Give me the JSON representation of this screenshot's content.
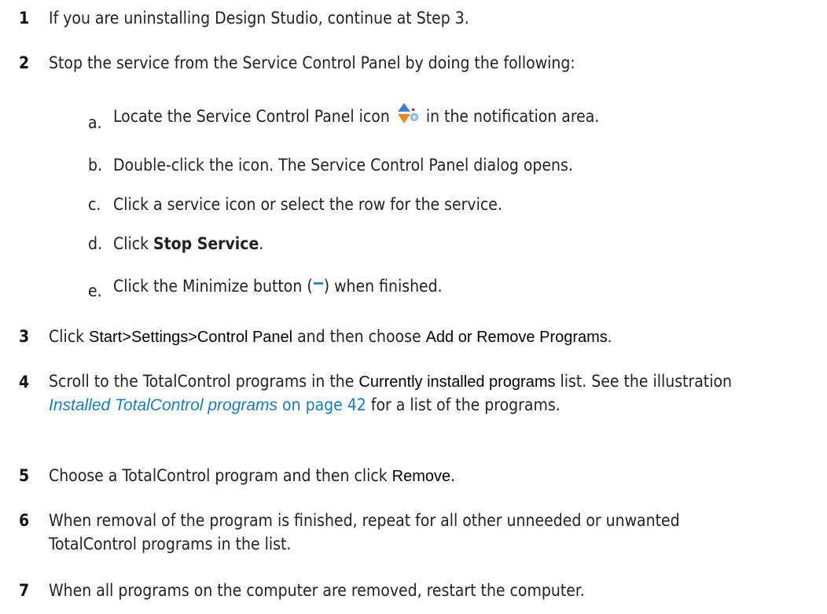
{
  "steps": [
    {
      "num": "1",
      "text": "If you are uninstalling Design Studio, continue at Step 3."
    },
    {
      "num": "2",
      "text": "Stop the service from the Service Control Panel by doing the following:"
    },
    {
      "num": "3",
      "pre": "Click ",
      "start": "Start",
      "gt1": ">",
      "settings": "Settings",
      "gt2": ">",
      "control_panel": "Control Panel",
      "mid": " and then choose ",
      "add_remove": "Add or Remove Programs."
    },
    {
      "num": "4",
      "pre": "Scroll to the TotalControl programs in the ",
      "list_name": "Currently installed programs",
      "mid": " list. See the illustration ",
      "link_italic": "Installed TotalControl programs",
      "link_page": " on page 42",
      "post": " for a list of the programs."
    },
    {
      "num": "5",
      "pre": "Choose a TotalControl program and then click ",
      "remove": "Remove",
      "post": "."
    },
    {
      "num": "6",
      "text": "When removal of the program is finished, repeat for all other unneeded or unwanted TotalControl programs in the list."
    },
    {
      "num": "7",
      "text": "When all programs on the computer are removed, restart the computer."
    }
  ],
  "substeps": [
    {
      "letter": "a.",
      "pre": "Locate the Service Control Panel icon ",
      "post": " in the notification area."
    },
    {
      "letter": "b.",
      "text": "Double-click the icon. The Service Control Panel dialog opens."
    },
    {
      "letter": "c.",
      "text": "Click a service icon or select the row for the service."
    },
    {
      "letter": "d.",
      "pre": "Click ",
      "bold": "Stop Service",
      "post": "."
    },
    {
      "letter": "e.",
      "pre": "Click the Minimize button (",
      "post": ") when finished."
    }
  ],
  "icons": {
    "service_control_panel": "service-control-panel-icon",
    "minimize": "minimize-icon"
  },
  "colors": {
    "link": "#1a7bbd",
    "icon_blue": "#3a7fd5",
    "icon_orange": "#f08a1c",
    "minimize_blue": "#2a8be0"
  }
}
